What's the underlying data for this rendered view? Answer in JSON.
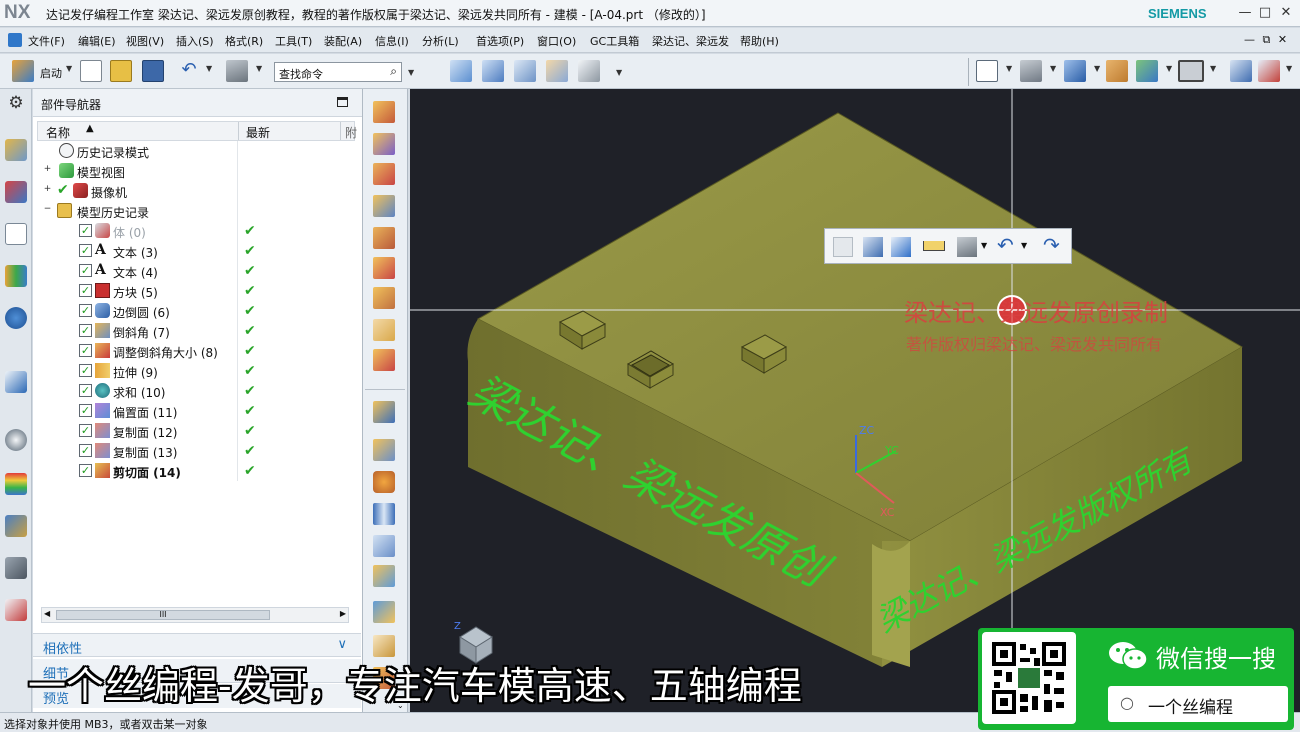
{
  "titlebar": {
    "logo": "NX",
    "title": "达记发仔编程工作室  梁达记、梁远发原创教程，教程的著作版权属于梁达记、梁远发共同所有 - 建模 - [A-04.prt （修改的）]",
    "brand": "SIEMENS",
    "minimize": "—",
    "maximize": "□",
    "close": "✕"
  },
  "menu": {
    "items": [
      "文件(F)",
      "编辑(E)",
      "视图(V)",
      "插入(S)",
      "格式(R)",
      "工具(T)",
      "装配(A)",
      "信息(I)",
      "分析(L)",
      "首选项(P)",
      "窗口(O)",
      "GC工具箱",
      "梁达记、梁远发",
      "帮助(H)"
    ],
    "controls": "— ⧉ ✕"
  },
  "toolbar": {
    "start": "启动",
    "search_placeholder": "查找命令"
  },
  "navigator": {
    "title": "部件导航器",
    "col_name": "名称",
    "col_latest": "最新",
    "col_extra": "附",
    "scroll_grip": "III",
    "rows": [
      {
        "label": "历史记录模式"
      },
      {
        "label": "模型视图"
      },
      {
        "label": "摄像机"
      },
      {
        "label": "模型历史记录"
      },
      {
        "label": "体 (0)"
      },
      {
        "label": "文本 (3)"
      },
      {
        "label": "文本 (4)"
      },
      {
        "label": "方块 (5)"
      },
      {
        "label": "边倒圆 (6)"
      },
      {
        "label": "倒斜角 (7)"
      },
      {
        "label": "调整倒斜角大小 (8)"
      },
      {
        "label": "拉伸 (9)"
      },
      {
        "label": "求和 (10)"
      },
      {
        "label": "偏置面 (11)"
      },
      {
        "label": "复制面 (12)"
      },
      {
        "label": "复制面 (13)"
      },
      {
        "label": "剪切面 (14)"
      }
    ],
    "sections": [
      "相依性",
      "细节",
      "预览"
    ]
  },
  "viewport": {
    "watermark_red_1": "梁达记、梁远发原创录制",
    "watermark_red_2": "著作版权归梁达记、梁远发共同所有",
    "green_text_1": "梁达记、梁远发原创",
    "green_text_2": "梁达记、梁远发版权所有",
    "axis_zc": "ZC",
    "axis_yc": "YC",
    "axis_xc": "XC",
    "mini_z": "Z"
  },
  "subtitle": "一个丝编程-发哥，专注汽车模高速、五轴编程",
  "wechat": {
    "title": "微信搜一搜",
    "search": "一个丝编程"
  },
  "status": "选择对象并使用 MB3，或者双击某一对象",
  "colors": {
    "model": "#8a8a3c",
    "green_text": "#2fd12f",
    "background": "#1f2128",
    "wechat": "#17b532"
  }
}
